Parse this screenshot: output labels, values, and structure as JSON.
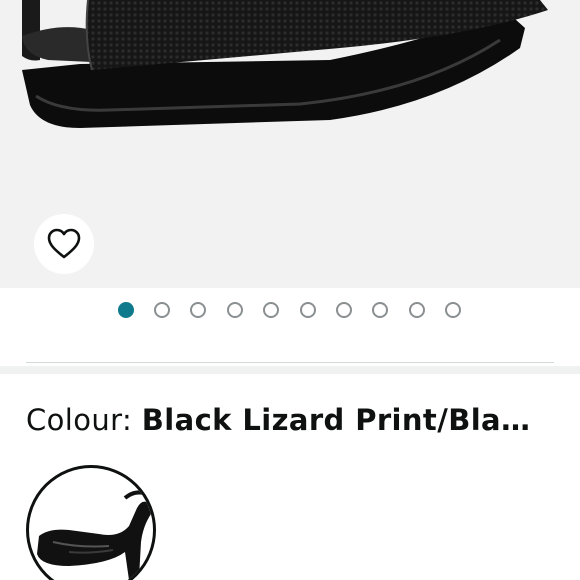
{
  "product": {
    "colour_label": "Colour: ",
    "colour_value": "Black Lizard Print/Bla…"
  },
  "gallery": {
    "image_count": 10,
    "active_index": 0
  },
  "icons": {
    "wishlist": "heart-icon"
  },
  "colors": {
    "active_dot": "#0e7a8b",
    "inactive_dot": "#8a8f91"
  }
}
